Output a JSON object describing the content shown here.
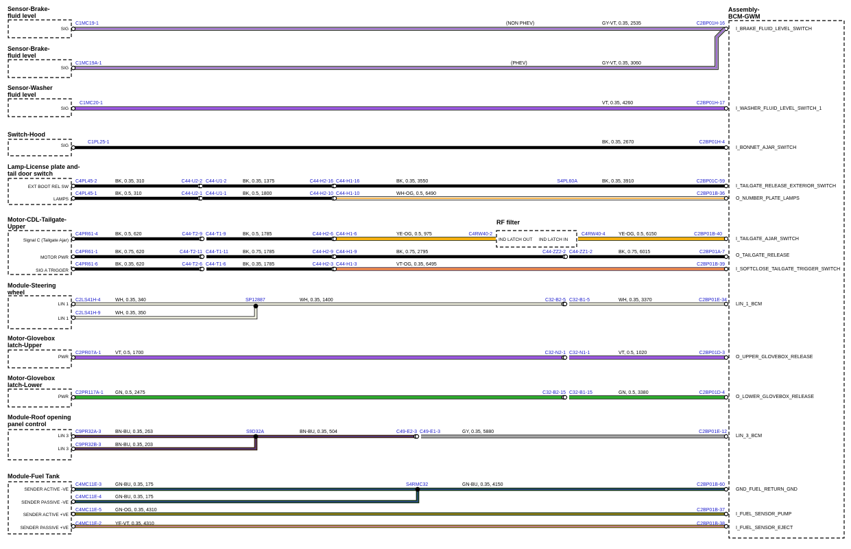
{
  "assembly": {
    "line1": "Assembly-",
    "line2": "BCM-GWM"
  },
  "rf_filter": {
    "title": "RF filter",
    "out_label": "IND LATCH OUT",
    "in_label": "IND LATCH IN"
  },
  "sections": [
    {
      "title": [
        "Sensor-Brake-",
        "fluid level"
      ]
    },
    {
      "title": [
        "Sensor-Brake-",
        "fluid level"
      ]
    },
    {
      "title": [
        "Sensor-Washer",
        "fluid level"
      ]
    },
    {
      "title": [
        "Switch-Hood"
      ]
    },
    {
      "title": [
        "Lamp-License plate and-",
        "tail door switch"
      ]
    },
    {
      "title": [
        "Motor-CDL-Tailgate-",
        "Upper"
      ]
    },
    {
      "title": [
        "Module-Steering",
        "wheel"
      ]
    },
    {
      "title": [
        "Motor-Glovebox",
        "latch-Upper"
      ]
    },
    {
      "title": [
        "Motor-Glovebox",
        "latch-Lower"
      ]
    },
    {
      "title": [
        "Module-Roof opening",
        "panel control"
      ]
    },
    {
      "title": [
        "Module-Fuel Tank"
      ]
    }
  ],
  "pins": [
    "SIG",
    "SIG",
    "SIG",
    "SIG",
    "EXT BOOT REL SW",
    "LAMPS",
    "Signal C (Tailgate Ajar)",
    "MOTOR PWR",
    "SIG A TRIGGER",
    "LIN 1",
    "LIN 1",
    "PWR",
    "PWR",
    "LIN 3",
    "LIN 3",
    "SENDER ACTIVE -VE",
    "SENDER PASSIVE -VE",
    "SENDER ACTIVE +VE",
    "SENDER PASSIVE +VE"
  ],
  "signals": [
    "I_BRAKE_FLUID_LEVEL_SWITCH",
    "I_WASHER_FLUID_LEVEL_SWITCH_1",
    "I_BONNET_AJAR_SWITCH",
    "I_TAILGATE_RELEASE_EXTERIOR_SWITCH",
    "O_NUMBER_PLATE_LAMPS",
    "I_TAILGATE_AJAR_SWITCH",
    "O_TAILGATE_RELEASE",
    "I_SOFTCLOSE_TAILGATE_TRIGGER_SWITCH",
    "LIN_1_BCM",
    "O_UPPER_GLOVEBOX_RELEASE",
    "O_LOWER_GLOVEBOX_RELEASE",
    "LIN_3_BCM",
    "GND_FUEL_RETURN_GND",
    "I_FUEL_SENSOR_PUMP",
    "I_FUEL_SENSOR_EJECT"
  ],
  "connectors": [
    "C1MC19-1",
    "C2BP01H-16",
    "C1MC19A-1",
    "C1MC20-1",
    "C2BP01H-17",
    "C1PL25-1",
    "C2BP01H-4",
    "C4PL45-2",
    "C44-U2-2",
    "C44-U1-2",
    "C44-H2-16",
    "C44-H1-16",
    "S4PL60A",
    "C2BP01C-59",
    "C4PL45-1",
    "C44-U2-1",
    "C44-U1-1",
    "C44-H2-10",
    "C44-H1-10",
    "C2BP01B-36",
    "C4PR61-4",
    "C44-T2-9",
    "C44-T1-9",
    "C44-H2-6",
    "C44-H1-6",
    "C4RW40-2",
    "C4RW40-4",
    "C2BP01B-40",
    "C4PR61-1",
    "C44-T2-11",
    "C44-T1-11",
    "C44-H2-9",
    "C44-H1-9",
    "C44-ZZ2-2",
    "C44-ZZ1-2",
    "C2BP01A-7",
    "C4PR61-6",
    "C44-T2-6",
    "C44-T1-6",
    "C44-H2-3",
    "C44-H1-3",
    "C2BP01B-39",
    "C2LS41H-4",
    "SP12887",
    "C32-B2-5",
    "C32-B1-5",
    "C2BP01E-34",
    "C2LS41H-9",
    "C2PR07A-1",
    "C32-N2-1",
    "C32-N1-1",
    "C2BP01D-3",
    "C2PR117A-1",
    "C32-B2-15",
    "C32-B1-15",
    "C2BP01D-4",
    "C9PR32A-3",
    "S9D32A",
    "C49-E2-3",
    "C49-E1-3",
    "C2BP01E-12",
    "C9PR32B-3",
    "C4MC11E-3",
    "S4RMC32",
    "C2BP01B-60",
    "C4MC11E-4",
    "C4MC11E-5",
    "C2BP01B-37",
    "C4MC11E-2",
    "C2BP01B-38"
  ],
  "wires": [
    "(NON PHEV)",
    "GY-VT,  0.35,  2535",
    "(PHEV)",
    "GY-VT,  0.35,  3060",
    "VT,  0.35,  4260",
    "BK,  0.35,  2670",
    "BK,  0.35,  310",
    "BK,  0.35,  1375",
    "BK,  0.35,  3550",
    "BK,  0.35,  3910",
    "BK,  0.5,  310",
    "BK,  0.5,  1800",
    "WH-OG,  0.5,  6490",
    "BK,  0.5,  620",
    "BK,  0.5,  1785",
    "YE-OG,  0.5,  975",
    "YE-OG,  0.5,  6150",
    "BK,  0.75,  620",
    "BK,  0.75,  1785",
    "BK,  0.75,  2795",
    "BK,  0.75,  6015",
    "BK,  0.35,  620",
    "BK,  0.35,  1785",
    "VT-OG,  0.35,  6495",
    "WH,  0.35,  340",
    "WH,  0.35,  1400",
    "WH,  0.35,  3370",
    "WH,  0.35,  350",
    "VT,  0.5,  1700",
    "VT,  0.5,  1020",
    "GN,  0.5,  2475",
    "GN,  0.5,  3380",
    "BN-BU,  0.35,  263",
    "BN-BU,  0.35,  504",
    "GY,  0.35,  5880",
    "BN-BU,  0.35,  203",
    "GN-BU,  0.35,  175",
    "GN-BU,  0.35,  4150",
    "GN-OG,  0.35,  4310",
    "YE-VT,  0.35,  4310"
  ],
  "colors": {
    "connector_text": "#1a1acc",
    "violet": "#9b59e0",
    "grey": "#a8a8a8",
    "black": "#000000",
    "white_wire": "#f4f4e4",
    "orange": "#ffa020",
    "yellow": "#f0c000",
    "pink": "#f08080",
    "brown": "#8b4513",
    "blue": "#3030b0",
    "green": "#2eaa2e",
    "dark_green": "#1e6e1e"
  }
}
